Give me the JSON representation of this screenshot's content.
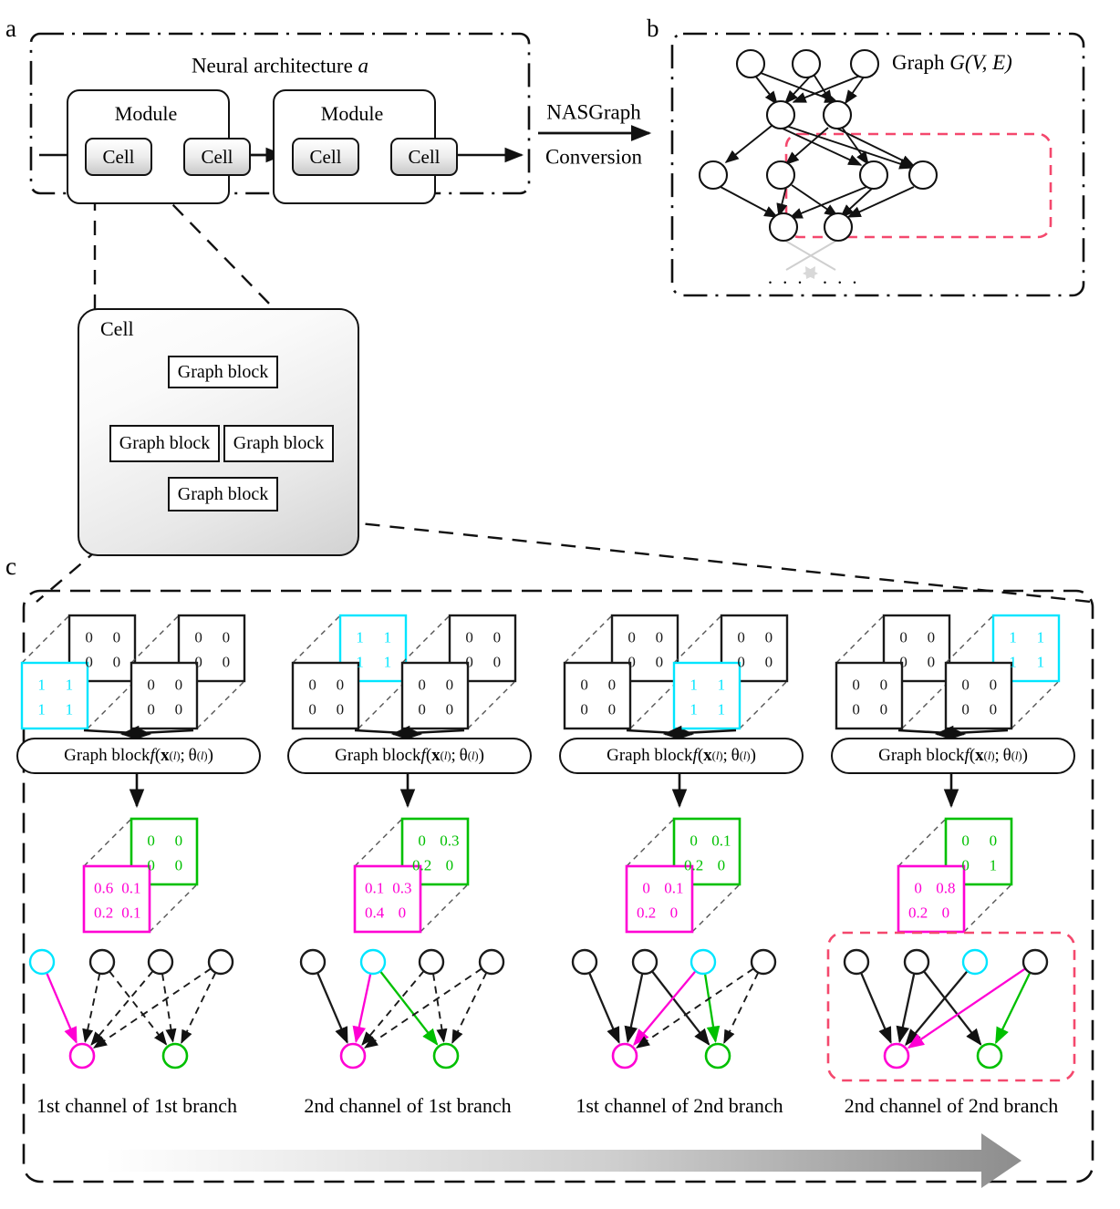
{
  "figure": {
    "panels": [
      "a",
      "b",
      "c"
    ]
  },
  "panel_a": {
    "letter": "a",
    "title_prefix": "Neural architecture ",
    "title_symbol": "a",
    "modules": [
      {
        "label": "Module",
        "cells": [
          "Cell",
          "Cell"
        ]
      },
      {
        "label": "Module",
        "cells": [
          "Cell",
          "Cell"
        ]
      }
    ]
  },
  "conversion": {
    "top_label": "NASGraph",
    "bottom_label": "Conversion",
    "arrow": "right-arrow-icon"
  },
  "panel_b": {
    "letter": "b",
    "title": "Graph G(V, E)",
    "title_plain": "Graph ",
    "title_math": "G(V, E)",
    "ellipsis_left": "· · ·",
    "ellipsis_right": "· · ·",
    "highlight_color": "#f4486d",
    "layers": [
      3,
      2,
      4,
      2
    ]
  },
  "cell_detail": {
    "title": "Cell",
    "blocks": [
      "Graph block",
      "Graph block",
      "Graph block",
      "Graph block"
    ]
  },
  "panel_c": {
    "letter": "c",
    "progress_arrow": "progress-arrow-icon",
    "colors": {
      "input_highlight": "#00e5ff",
      "output_magenta": "#ff00d4",
      "output_green": "#00c000",
      "inactive": "#1a1a1a",
      "highlight_box": "#f4486d"
    },
    "block_label_plain": "Graph block ",
    "block_label_math": "f(x(l); θ(l))",
    "columns": [
      {
        "caption": "1st channel of 1st branch",
        "highlight_index": 0,
        "inputs": [
          {
            "front": [
              "1",
              "1",
              "1",
              "1"
            ],
            "back": [
              "0",
              "0",
              "0",
              "0"
            ],
            "front_color": "cyan",
            "back_color": "black"
          },
          {
            "front": [
              "0",
              "0",
              "0",
              "0"
            ],
            "back": [
              "0",
              "0",
              "0",
              "0"
            ],
            "front_color": "black",
            "back_color": "black"
          }
        ],
        "outputs": {
          "magenta": [
            "0.6",
            "0.1",
            "0.2",
            "0.1"
          ],
          "green": [
            "0",
            "0",
            "0",
            "0"
          ]
        },
        "graph": {
          "top_nodes": [
            "cyan",
            "black",
            "black",
            "black"
          ],
          "bottom_nodes": [
            "magenta",
            "green"
          ],
          "edges": [
            {
              "from": 0,
              "to": 0,
              "style": "solid",
              "color": "magenta"
            },
            {
              "from": 1,
              "to": 0,
              "style": "dashed",
              "color": "black"
            },
            {
              "from": 1,
              "to": 1,
              "style": "dashed",
              "color": "black"
            },
            {
              "from": 2,
              "to": 0,
              "style": "dashed",
              "color": "black"
            },
            {
              "from": 2,
              "to": 1,
              "style": "dashed",
              "color": "black"
            },
            {
              "from": 3,
              "to": 0,
              "style": "dashed",
              "color": "black"
            },
            {
              "from": 3,
              "to": 1,
              "style": "dashed",
              "color": "black"
            }
          ],
          "boxed": false
        }
      },
      {
        "caption": "2nd channel of 1st branch",
        "highlight_index": 1,
        "inputs": [
          {
            "front": [
              "0",
              "0",
              "0",
              "0"
            ],
            "back": [
              "1",
              "1",
              "1",
              "1"
            ],
            "front_color": "black",
            "back_color": "cyan"
          },
          {
            "front": [
              "0",
              "0",
              "0",
              "0"
            ],
            "back": [
              "0",
              "0",
              "0",
              "0"
            ],
            "front_color": "black",
            "back_color": "black"
          }
        ],
        "outputs": {
          "magenta": [
            "0.1",
            "0.3",
            "0.4",
            "0"
          ],
          "green": [
            "0",
            "0.3",
            "0.2",
            "0"
          ]
        },
        "graph": {
          "top_nodes": [
            "black",
            "cyan",
            "black",
            "black"
          ],
          "bottom_nodes": [
            "magenta",
            "green"
          ],
          "edges": [
            {
              "from": 0,
              "to": 0,
              "style": "solid",
              "color": "black"
            },
            {
              "from": 1,
              "to": 0,
              "style": "solid",
              "color": "magenta"
            },
            {
              "from": 1,
              "to": 1,
              "style": "solid",
              "color": "green"
            },
            {
              "from": 2,
              "to": 0,
              "style": "dashed",
              "color": "black"
            },
            {
              "from": 2,
              "to": 1,
              "style": "dashed",
              "color": "black"
            },
            {
              "from": 3,
              "to": 0,
              "style": "dashed",
              "color": "black"
            },
            {
              "from": 3,
              "to": 1,
              "style": "dashed",
              "color": "black"
            }
          ],
          "boxed": false
        }
      },
      {
        "caption": "1st channel of 2nd branch",
        "highlight_index": 2,
        "inputs": [
          {
            "front": [
              "0",
              "0",
              "0",
              "0"
            ],
            "back": [
              "0",
              "0",
              "0",
              "0"
            ],
            "front_color": "black",
            "back_color": "black"
          },
          {
            "front": [
              "1",
              "1",
              "1",
              "1"
            ],
            "back": [
              "0",
              "0",
              "0",
              "0"
            ],
            "front_color": "cyan",
            "back_color": "black"
          }
        ],
        "outputs": {
          "magenta": [
            "0",
            "0.1",
            "0.2",
            "0"
          ],
          "green": [
            "0",
            "0.1",
            "0.2",
            "0"
          ]
        },
        "graph": {
          "top_nodes": [
            "black",
            "black",
            "cyan",
            "black"
          ],
          "bottom_nodes": [
            "magenta",
            "green"
          ],
          "edges": [
            {
              "from": 0,
              "to": 0,
              "style": "solid",
              "color": "black"
            },
            {
              "from": 1,
              "to": 0,
              "style": "solid",
              "color": "black"
            },
            {
              "from": 1,
              "to": 1,
              "style": "solid",
              "color": "black"
            },
            {
              "from": 2,
              "to": 0,
              "style": "solid",
              "color": "magenta"
            },
            {
              "from": 2,
              "to": 1,
              "style": "solid",
              "color": "green"
            },
            {
              "from": 3,
              "to": 0,
              "style": "dashed",
              "color": "black"
            },
            {
              "from": 3,
              "to": 1,
              "style": "dashed",
              "color": "black"
            }
          ],
          "boxed": false
        }
      },
      {
        "caption": "2nd channel of 2nd branch",
        "highlight_index": 3,
        "inputs": [
          {
            "front": [
              "0",
              "0",
              "0",
              "0"
            ],
            "back": [
              "0",
              "0",
              "0",
              "0"
            ],
            "front_color": "black",
            "back_color": "black"
          },
          {
            "front": [
              "0",
              "0",
              "0",
              "0"
            ],
            "back": [
              "1",
              "1",
              "1",
              "1"
            ],
            "front_color": "black",
            "back_color": "cyan"
          }
        ],
        "outputs": {
          "magenta": [
            "0",
            "0.8",
            "0.2",
            "0"
          ],
          "green": [
            "0",
            "0",
            "0",
            "1"
          ]
        },
        "graph": {
          "top_nodes": [
            "black",
            "black",
            "cyan",
            "black"
          ],
          "bottom_nodes": [
            "magenta",
            "green"
          ],
          "edges": [
            {
              "from": 0,
              "to": 0,
              "style": "solid",
              "color": "black"
            },
            {
              "from": 1,
              "to": 0,
              "style": "solid",
              "color": "black"
            },
            {
              "from": 1,
              "to": 1,
              "style": "solid",
              "color": "black"
            },
            {
              "from": 2,
              "to": 0,
              "style": "solid",
              "color": "black"
            },
            {
              "from": 3,
              "to": 0,
              "style": "solid",
              "color": "magenta"
            },
            {
              "from": 3,
              "to": 1,
              "style": "solid",
              "color": "green"
            }
          ],
          "boxed": true
        }
      }
    ]
  }
}
